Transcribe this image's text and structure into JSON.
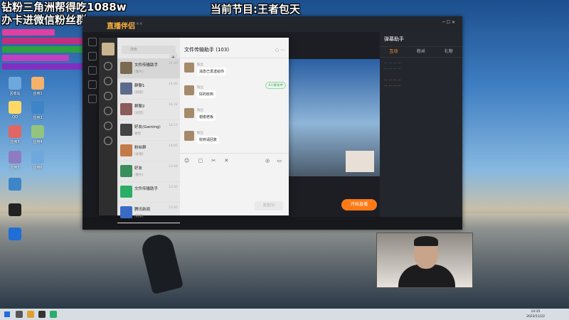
{
  "overlay": {
    "left_line1": "钻粉三角洲帮得吃1088w",
    "left_line2": "办卡进微信粉丝群",
    "right_line": "当前节目:王者包天"
  },
  "app": {
    "logo": "直播伴侣",
    "version": "v2.4.4",
    "right_tab": "弹幕助手",
    "tabs": [
      "互动",
      "粉丝",
      "礼物"
    ],
    "live_button": "开始直播"
  },
  "wechat": {
    "search_placeholder": "搜索",
    "chat_title": "文件传输助手 (103)",
    "tag": "4人接龙中",
    "send_label": "发送(S)",
    "contacts": [
      {
        "name": "文件传输助手",
        "time": "14:35",
        "msg": "[图片]"
      },
      {
        "name": "群聊1",
        "time": "14:30",
        "msg": "[链接]"
      },
      {
        "name": "群聊2",
        "time": "14:22",
        "msg": "[语音]"
      },
      {
        "name": "好友(Gaming)",
        "time": "14:15",
        "msg": "收到"
      },
      {
        "name": "粉丝群",
        "time": "14:05",
        "msg": "[表情]"
      },
      {
        "name": "好友",
        "time": "13:58",
        "msg": "[图片]"
      },
      {
        "name": "文件传输助手",
        "time": "13:40",
        "msg": ""
      },
      {
        "name": "腾讯新闻",
        "time": "13:20",
        "msg": "[链接]"
      }
    ],
    "messages": [
      {
        "name": "粉丝",
        "text": "消息已发送给你"
      },
      {
        "name": "粉丝",
        "text": "好的收到"
      },
      {
        "name": "粉丝",
        "text": "谢谢老板"
      },
      {
        "name": "粉丝",
        "text": "收到请回复"
      }
    ]
  },
  "desktop_icons": [
    {
      "label": "回收站",
      "color": "#6fa8dc"
    },
    {
      "label": "应用1",
      "color": "#f6b26b"
    },
    {
      "label": "QQ",
      "color": "#ffd966"
    },
    {
      "label": "应用2",
      "color": "#3d85c6"
    },
    {
      "label": "应用3",
      "color": "#e06666"
    },
    {
      "label": "应用4",
      "color": "#93c47d"
    },
    {
      "label": "应用5",
      "color": "#8e7cc3"
    },
    {
      "label": "应用6",
      "color": "#6fa8dc"
    }
  ],
  "taskbar": {
    "time": "14:35",
    "date": "2023/11/22"
  }
}
